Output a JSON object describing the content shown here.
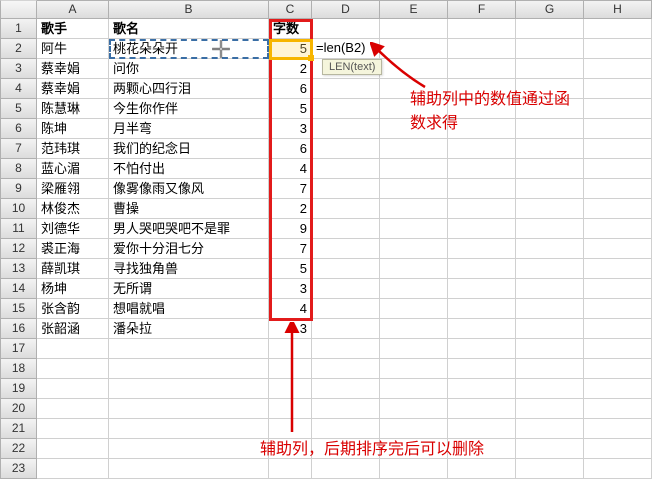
{
  "columns": [
    "A",
    "B",
    "C",
    "D",
    "E",
    "F",
    "G",
    "H"
  ],
  "headers": {
    "A": "歌手",
    "B": "歌名",
    "C": "字数"
  },
  "rows": [
    {
      "A": "阿牛",
      "B": "桃花朵朵开",
      "C": 5
    },
    {
      "A": "蔡幸娟",
      "B": "问你",
      "C": 2
    },
    {
      "A": "蔡幸娟",
      "B": "两颗心四行泪",
      "C": 6
    },
    {
      "A": "陈慧琳",
      "B": "今生你作伴",
      "C": 5
    },
    {
      "A": "陈坤",
      "B": "月半弯",
      "C": 3
    },
    {
      "A": "范玮琪",
      "B": "我们的纪念日",
      "C": 6
    },
    {
      "A": "蓝心湄",
      "B": "不怕付出",
      "C": 4
    },
    {
      "A": "梁雁翎",
      "B": "像雾像雨又像风",
      "C": 7
    },
    {
      "A": "林俊杰",
      "B": "曹操",
      "C": 2
    },
    {
      "A": "刘德华",
      "B": "男人哭吧哭吧不是罪",
      "C": 9
    },
    {
      "A": "裘正海",
      "B": "爱你十分泪七分",
      "C": 7
    },
    {
      "A": "薛凯琪",
      "B": "寻找独角兽",
      "C": 5
    },
    {
      "A": "杨坤",
      "B": "无所谓",
      "C": 3
    },
    {
      "A": "张含韵",
      "B": "想唱就唱",
      "C": 4
    },
    {
      "A": "张韶涵",
      "B": "潘朵拉",
      "C": 3
    }
  ],
  "empty_rows": [
    17,
    18,
    19,
    20,
    21,
    22,
    23
  ],
  "formula_display": "=len(B2)",
  "hint_text": "LEN(text)",
  "annotation1_line1": "辅助列中的数值通过函",
  "annotation1_line2": "数求得",
  "annotation2": "辅助列，后期排序完后可以删除",
  "chart_data": {
    "type": "table",
    "title": "",
    "columns": [
      "歌手",
      "歌名",
      "字数"
    ],
    "data": [
      [
        "阿牛",
        "桃花朵朵开",
        5
      ],
      [
        "蔡幸娟",
        "问你",
        2
      ],
      [
        "蔡幸娟",
        "两颗心四行泪",
        6
      ],
      [
        "陈慧琳",
        "今生你作伴",
        5
      ],
      [
        "陈坤",
        "月半弯",
        3
      ],
      [
        "范玮琪",
        "我们的纪念日",
        6
      ],
      [
        "蓝心湄",
        "不怕付出",
        4
      ],
      [
        "梁雁翎",
        "像雾像雨又像风",
        7
      ],
      [
        "林俊杰",
        "曹操",
        2
      ],
      [
        "刘德华",
        "男人哭吧哭吧不是罪",
        9
      ],
      [
        "裘正海",
        "爱你十分泪七分",
        7
      ],
      [
        "薛凯琪",
        "寻找独角兽",
        5
      ],
      [
        "杨坤",
        "无所谓",
        3
      ],
      [
        "张含韵",
        "想唱就唱",
        4
      ],
      [
        "张韶涵",
        "潘朵拉",
        3
      ]
    ]
  }
}
